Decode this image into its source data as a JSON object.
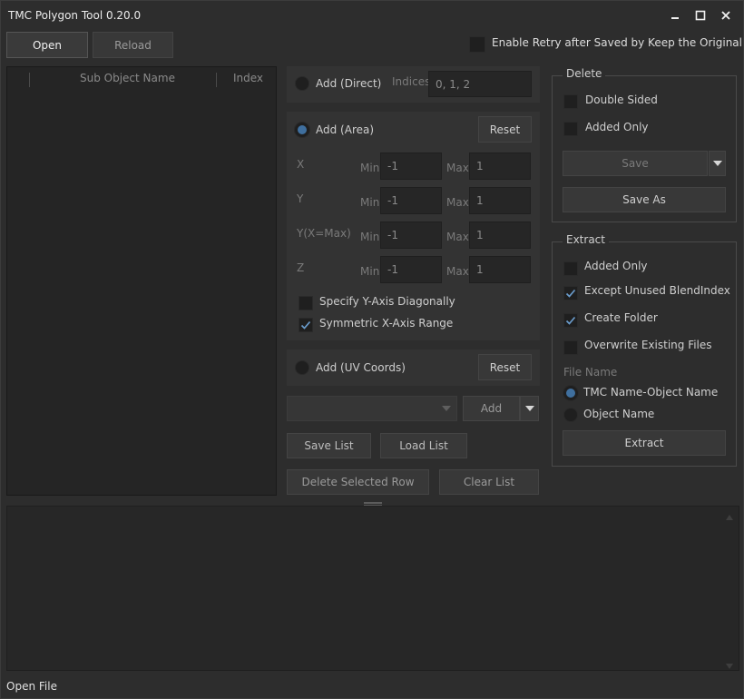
{
  "window": {
    "title": "TMC Polygon Tool 0.20.0",
    "minimize_glyph": "▁",
    "maximize_glyph": "☐",
    "close_glyph": "✕"
  },
  "toolbar": {
    "open_label": "Open",
    "reload_label": "Reload",
    "retry_label": "Enable Retry after Saved by Keep the Original Data",
    "retry_checked": false
  },
  "table": {
    "col_name": "Sub Object Name",
    "col_index": "Index"
  },
  "add_direct": {
    "label": "Add (Direct)",
    "indices_label": "Indices",
    "indices_value": "0, 1, 2"
  },
  "add_area": {
    "label": "Add (Area)",
    "reset_label": "Reset",
    "min_label": "Min",
    "max_label": "Max",
    "rows": [
      {
        "axis": "X",
        "min": "-1",
        "max": "1"
      },
      {
        "axis": "Y",
        "min": "-1",
        "max": "1"
      },
      {
        "axis": "Y(X=Max)",
        "min": "-1",
        "max": "1"
      },
      {
        "axis": "Z",
        "min": "-1",
        "max": "1"
      }
    ],
    "specify_y_label": "Specify Y-Axis Diagonally",
    "symmetric_x_label": "Symmetric X-Axis Range"
  },
  "add_uv": {
    "label": "Add (UV Coords)",
    "reset_label": "Reset"
  },
  "list_controls": {
    "add_label": "Add",
    "save_list_label": "Save List",
    "load_list_label": "Load List",
    "delete_row_label": "Delete Selected Row",
    "clear_list_label": "Clear List"
  },
  "delete_group": {
    "title": "Delete",
    "double_sided_label": "Double Sided",
    "added_only_label": "Added Only",
    "save_label": "Save",
    "save_as_label": "Save As"
  },
  "extract_group": {
    "title": "Extract",
    "added_only_label": "Added Only",
    "except_unused_label": "Except Unused BlendIndex",
    "create_folder_label": "Create Folder",
    "overwrite_label": "Overwrite Existing Files",
    "file_name_label": "File Name",
    "tmc_object_label": "TMC Name-Object Name",
    "object_label": "Object Name",
    "extract_label": "Extract"
  },
  "status": {
    "text": "Open File"
  },
  "colors": {
    "background": "#2d2d2d",
    "panel": "#333333",
    "accent": "#3f6f9e"
  }
}
